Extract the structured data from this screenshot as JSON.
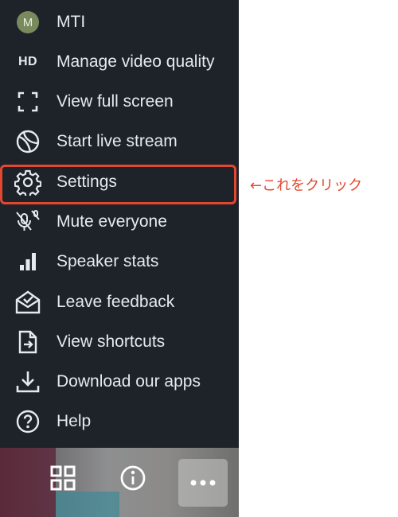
{
  "menu": {
    "items": [
      {
        "label": "MTI",
        "icon": "avatar-icon",
        "avatar_letter": "M"
      },
      {
        "label": "Manage video quality",
        "icon": "hd-icon",
        "icon_text": "HD"
      },
      {
        "label": "View full screen",
        "icon": "fullscreen-icon"
      },
      {
        "label": "Start live stream",
        "icon": "globe-icon"
      },
      {
        "label": "Settings",
        "icon": "gear-icon"
      },
      {
        "label": "Mute everyone",
        "icon": "mute-icon"
      },
      {
        "label": "Speaker stats",
        "icon": "bar-chart-icon"
      },
      {
        "label": "Leave feedback",
        "icon": "feedback-icon"
      },
      {
        "label": "View shortcuts",
        "icon": "shortcuts-icon"
      },
      {
        "label": "Download our apps",
        "icon": "download-icon"
      },
      {
        "label": "Help",
        "icon": "help-icon"
      }
    ]
  },
  "annotation": {
    "text": "←これをクリック"
  },
  "colors": {
    "menu_bg": "#1e232a",
    "highlight": "#e4472f",
    "text": "#e6e9ee"
  }
}
